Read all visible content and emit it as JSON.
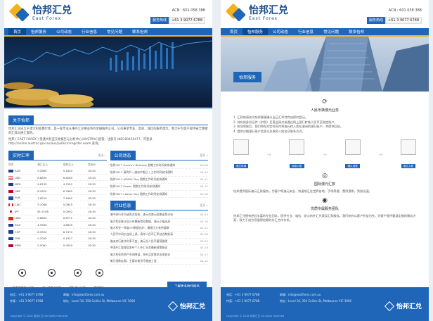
{
  "brand": {
    "name_cn": "怡邦汇兑",
    "name_en": "East Forex",
    "acn": "ACN : 601 058 388",
    "phone_label": "服务热线",
    "phone": "+61 3 9077 6788"
  },
  "nav": [
    "首页",
    "怡邦服务",
    "公司动态",
    "行业信息",
    "常见问题",
    "联系怡邦"
  ],
  "about": {
    "title": "关于怡邦",
    "paragraphs": [
      "怡邦汇兑成立于澳大利亚墨尔本，是一家专业从事外汇兑换业务的金融服务公司。公司秉承专业、高效、诚信的服务理念，致力于为客户提供安全便捷的汇款与换汇服务。",
      "怡邦 ( EAST FOREX ) 受澳大利亚交易报告与分析中心(AUSTRAC)监管，注册号 IND100426477，可登录 http://online.austrac.gov.au/aus/public/rsregister.seam 查询。"
    ]
  },
  "rates": {
    "title": "实时汇率",
    "more": "更多 »",
    "headers": [
      "货币",
      "现汇买入",
      "现钞买入",
      "卖出价"
    ],
    "rows": [
      {
        "flag": "au",
        "cols": [
          "AUD",
          "5.2665",
          "5.1840",
          "18:30"
        ]
      },
      {
        "flag": "us",
        "cols": [
          "USD",
          "6.8830",
          "6.8280",
          "18:30"
        ]
      },
      {
        "flag": "nz",
        "cols": [
          "NZD",
          "4.8745",
          "4.7922",
          "18:30"
        ]
      },
      {
        "flag": "gb",
        "cols": [
          "GBP",
          "8.9320",
          "8.7665",
          "18:30"
        ]
      },
      {
        "flag": "eu",
        "cols": [
          "EUR",
          "7.6220",
          "7.4905",
          "18:30"
        ]
      },
      {
        "flag": "ca",
        "cols": [
          "CAD",
          "5.2088",
          "5.0945",
          "18:30"
        ]
      },
      {
        "flag": "jp",
        "cols": [
          "JPY",
          "81.5198",
          "0.0592",
          "18:30"
        ]
      },
      {
        "flag": "hk",
        "cols": [
          "HKD",
          "0.8845",
          "0.8771",
          "18:30"
        ]
      },
      {
        "flag": "au",
        "cols": [
          "SGD",
          "4.9565",
          "4.8605",
          "18:30"
        ]
      },
      {
        "flag": "au",
        "cols": [
          "CHF",
          "6.9320",
          "6.7470",
          "18:30"
        ]
      },
      {
        "flag": "nz",
        "cols": [
          "THB",
          "0.2005",
          "0.1927",
          "18:30"
        ]
      },
      {
        "flag": "gb",
        "cols": [
          "KRW",
          "0.0061",
          "0.0059",
          "18:30"
        ]
      }
    ]
  },
  "company_news": {
    "title": "公司动态",
    "more": "更多 »",
    "items": [
      {
        "t": "怡邦2017 Queen's Birthday 假期工作时间安排通知",
        "d": "06-06"
      },
      {
        "t": "怡邦2017 清明节 ( 澳洲节假日 ) 工作时间安排通知",
        "d": "04-12"
      },
      {
        "t": "怡邦2017 ANZAC Day 假期工作时间安排通知",
        "d": "04-21"
      },
      {
        "t": "怡邦2017 Easter 假期工作时间安排通知",
        "d": "04-12"
      },
      {
        "t": "怡邦2017 Labour Day 假期工作时间安排通知",
        "d": "03-10"
      }
    ]
  },
  "industry_news": {
    "title": "行业信息",
    "more": "更多 »",
    "items": [
      {
        "t": "澳中央行年内或再次加息，澳元兑美元短期走势分析",
        "d": "05-24"
      },
      {
        "t": "澳大利亚统计局公布最新就业数据，澳元小幅走高",
        "d": "05-18"
      },
      {
        "t": "澳大利亚一季度CPI数据出炉，通胀压力有所缓解",
        "d": "05-12"
      },
      {
        "t": "人民币中间价连续上调，离岸人民币汇率创近期新高",
        "d": "05-08"
      },
      {
        "t": "澳洲央行维持利率不变，澳元兑人民币震荡整理",
        "d": "05-03"
      },
      {
        "t": "中国外汇管理局发布个人外汇业务最新政策解读",
        "d": "04-28"
      },
      {
        "t": "澳大利亚房地产市场降温，海外买家需求出现变化",
        "d": "04-22"
      },
      {
        "t": "美元指数走弱，主要非美货币普遍上涨",
        "d": "04-15"
      }
    ]
  },
  "services_icons": [
    {
      "icon": "person-icon",
      "label": "人民币兑换澳元汇款"
    },
    {
      "icon": "shield-icon",
      "label": "澳元兑换人民币"
    },
    {
      "icon": "globe-icon",
      "label": "国际澳元汇款"
    },
    {
      "icon": "card-icon",
      "label": "预约换汇"
    }
  ],
  "cta": "了解更多怡邦服务",
  "footer": {
    "phone_label": "电话：",
    "phone": "+61 3 9077 6788",
    "fax_label": "传真：",
    "fax": "+61 3 9077 6788",
    "email_label": "邮箱：",
    "email": "info@eastforex.com.au",
    "addr_label": "地址：",
    "addr": "Level 10, 350 Collins St, Melbourne VIC 3000",
    "copyright": "Copyright © 2016 怡邦汇兑 All rights reserved",
    "logo_cn": "怡邦汇兑"
  },
  "service_page": {
    "hero_tag": "怡邦服务",
    "block1_title": "人民币换澳元业务",
    "block1_lines": [
      "1. 汇款前请先向怡邦客服确认当日汇率并完成预约登记。",
      "2. 持有效身份证件（护照）至营业网点或通过网上银行转账人民币至指定账户。",
      "3. 款项到账后，我们将在约定时间内将澳元转入您在澳洲的银行账户，并提供回执。",
      "4. 提供详细银行账户信息以及收款人姓名及联系方式。"
    ],
    "flow": [
      "提交申请",
      "存款入账",
      "确认到账",
      "澳元入账"
    ],
    "block2_title": "国际澳元汇款",
    "block2_text": "怡邦提供国际澳元汇款服务，为客户将澳元安全、快速地汇往世界各地，手续简便，费用透明，到账迅速。",
    "block3_title": "优质专属服务团队",
    "block3_text": "怡邦汇兑拥有经验丰富的专业团队，提供专业、诚信、贴心的外汇兑换及汇款服务。我们始终以客户利益为先，为客户提供量身定制的服务方案，致力于成为您值得信赖的外汇合作伙伴。"
  },
  "colors": {
    "brand_blue": "#1f66b8",
    "brand_gold": "#f2b21b"
  }
}
